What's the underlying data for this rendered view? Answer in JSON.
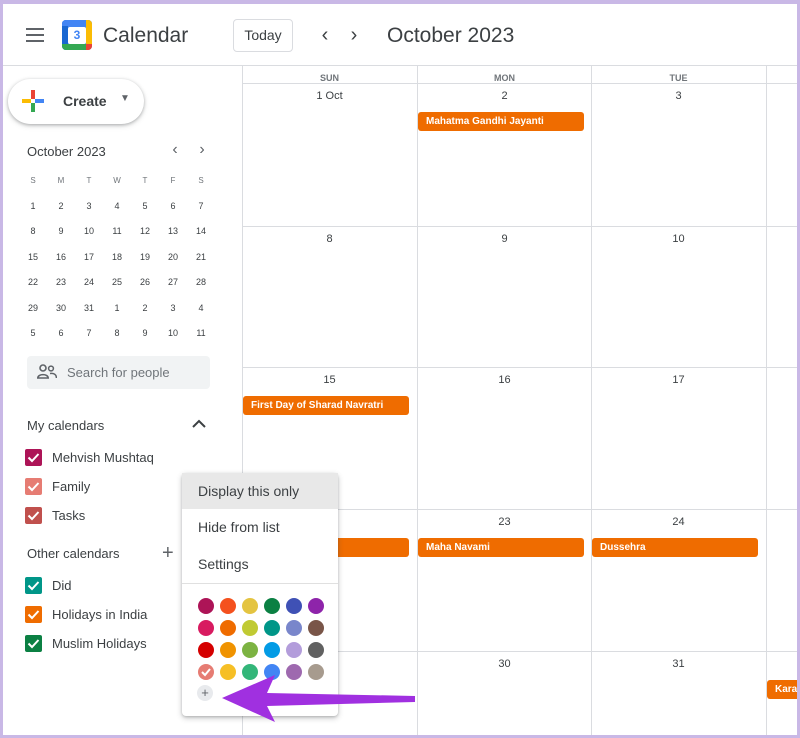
{
  "header": {
    "app_title": "Calendar",
    "logo_number": "3",
    "today_label": "Today",
    "prev_label": "‹",
    "next_label": "›",
    "month_title": "October 2023"
  },
  "sidebar": {
    "create_label": "Create",
    "mini_calendar": {
      "title": "October 2023",
      "prev": "‹",
      "next": "›",
      "weekdays": [
        "S",
        "M",
        "T",
        "W",
        "T",
        "F",
        "S"
      ],
      "weeks": [
        [
          "1",
          "2",
          "3",
          "4",
          "5",
          "6",
          "7"
        ],
        [
          "8",
          "9",
          "10",
          "11",
          "12",
          "13",
          "14"
        ],
        [
          "15",
          "16",
          "17",
          "18",
          "19",
          "20",
          "21"
        ],
        [
          "22",
          "23",
          "24",
          "25",
          "26",
          "27",
          "28"
        ],
        [
          "29",
          "30",
          "31",
          "1",
          "2",
          "3",
          "4"
        ],
        [
          "5",
          "6",
          "7",
          "8",
          "9",
          "10",
          "11"
        ]
      ]
    },
    "search_people_placeholder": "Search for people",
    "my_calendars": {
      "title": "My calendars",
      "items": [
        {
          "label": "Mehvish Mushtaq",
          "color": "#ad1457"
        },
        {
          "label": "Family",
          "color": "#e67c73"
        },
        {
          "label": "Tasks",
          "color": "#c0504d"
        }
      ]
    },
    "other_calendars": {
      "title": "Other calendars",
      "add_label": "+",
      "items": [
        {
          "label": "Did",
          "color": "#009688"
        },
        {
          "label": "Holidays in India",
          "color": "#ef6c00"
        },
        {
          "label": "Muslim Holidays",
          "color": "#0b8043"
        }
      ]
    }
  },
  "grid": {
    "day_headers": [
      "SUN",
      "MON",
      "TUE"
    ],
    "weeks": [
      [
        "1 Oct",
        "2",
        "3"
      ],
      [
        "8",
        "9",
        "10"
      ],
      [
        "15",
        "16",
        "17"
      ],
      [
        "",
        "23",
        "24"
      ],
      [
        "",
        "30",
        "31"
      ]
    ],
    "events": {
      "gandhi": "Mahatma Gandhi Jayanti",
      "navratri": "First Day of Sharad Navratri",
      "navami": "Maha Navami",
      "dussehra": "Dussehra",
      "karva": "Karal"
    },
    "event_color": "#ef6c00"
  },
  "popup": {
    "items": [
      "Display this only",
      "Hide from list",
      "Settings"
    ],
    "add_color": "+",
    "swatches": [
      [
        "#ad1457",
        "#f4511e",
        "#e4c441",
        "#0b8043",
        "#3f51b5",
        "#8e24aa"
      ],
      [
        "#d81b60",
        "#ef6c00",
        "#c0ca33",
        "#009688",
        "#7986cb",
        "#795548"
      ],
      [
        "#d50000",
        "#f09300",
        "#7cb342",
        "#039be5",
        "#b39ddb",
        "#616161"
      ],
      [
        "#e67c73",
        "#f6bf26",
        "#33b679",
        "#4285f4",
        "#9e69af",
        "#a79b8e"
      ]
    ]
  },
  "colors": {
    "accent_arrow": "#a030e0"
  }
}
